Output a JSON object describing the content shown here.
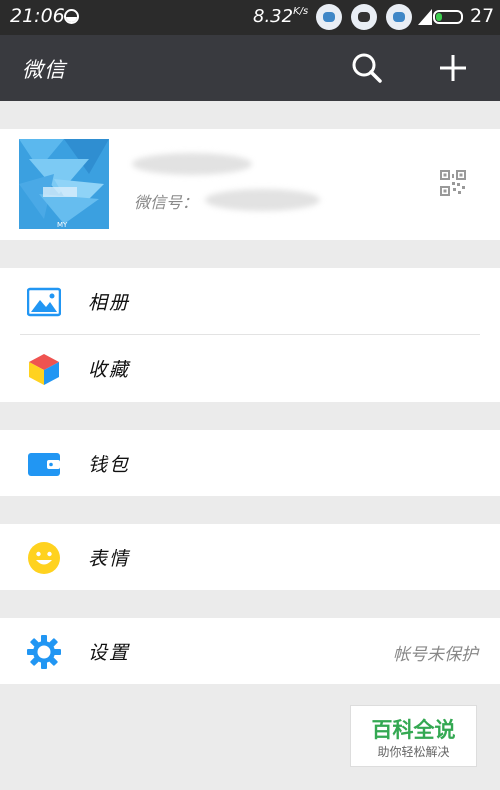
{
  "status_bar": {
    "time": "21:06",
    "network_speed": "8.32",
    "network_speed_unit": "K/s",
    "battery_level": "27",
    "network_type": "4G",
    "battery_color": "#3ecf4f"
  },
  "header": {
    "title": "微信",
    "icons": [
      "search-icon",
      "plus-icon"
    ]
  },
  "profile": {
    "wechat_id_label": "微信号：",
    "avatar_badge": "MY"
  },
  "menu": {
    "album": {
      "label": "相册",
      "icon": "album-icon"
    },
    "favorites": {
      "label": "收藏",
      "icon": "favorites-cube-icon"
    },
    "wallet": {
      "label": "钱包",
      "icon": "wallet-icon"
    },
    "stickers": {
      "label": "表情",
      "icon": "smiley-icon"
    },
    "settings": {
      "label": "设置",
      "value": "帐号未保护",
      "icon": "gear-icon"
    }
  },
  "watermark": {
    "brand": "百科全说",
    "slogan": "助你轻松解决"
  },
  "colors": {
    "titlebar": "#393a3f",
    "statusbar": "#2b2b2b",
    "accent_blue": "#2196f3",
    "smiley_yellow": "#ffd21f",
    "watermark_green": "#34a852"
  }
}
